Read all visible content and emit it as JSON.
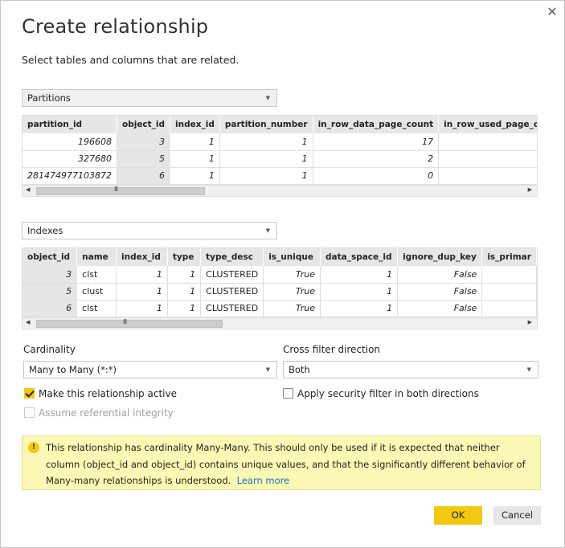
{
  "dialog": {
    "title": "Create relationship",
    "subtitle": "Select tables and columns that are related.",
    "close_glyph": "✕"
  },
  "table1": {
    "selected": "Partitions",
    "columns": [
      "partition_id",
      "object_id",
      "index_id",
      "partition_number",
      "in_row_data_page_count",
      "in_row_used_page_count"
    ],
    "rows": [
      [
        "196608",
        "3",
        "1",
        "1",
        "17",
        ""
      ],
      [
        "327680",
        "5",
        "1",
        "1",
        "2",
        ""
      ],
      [
        "281474977103872",
        "6",
        "1",
        "1",
        "0",
        ""
      ]
    ],
    "selected_column": "object_id"
  },
  "table2": {
    "selected": "Indexes",
    "columns": [
      "object_id",
      "name",
      "index_id",
      "type",
      "type_desc",
      "is_unique",
      "data_space_id",
      "ignore_dup_key",
      "is_primar"
    ],
    "rows": [
      [
        "3",
        "clst",
        "1",
        "1",
        "CLUSTERED",
        "True",
        "1",
        "False",
        ""
      ],
      [
        "5",
        "clust",
        "1",
        "1",
        "CLUSTERED",
        "True",
        "1",
        "False",
        ""
      ],
      [
        "6",
        "clst",
        "1",
        "1",
        "CLUSTERED",
        "True",
        "1",
        "False",
        ""
      ]
    ],
    "selected_column": "object_id"
  },
  "scrollbar": {
    "grip": "III",
    "left": "◀",
    "right": "▶"
  },
  "cardinality": {
    "label": "Cardinality",
    "value": "Many to Many (*:*)"
  },
  "crossfilter": {
    "label": "Cross filter direction",
    "value": "Both"
  },
  "options": {
    "active_label": "Make this relationship active",
    "active_checked": true,
    "security_label": "Apply security filter in both directions",
    "security_checked": false,
    "integrity_label": "Assume referential integrity",
    "integrity_checked": false
  },
  "warning": {
    "icon": "!",
    "text": "This relationship has cardinality Many-Many. This should only be used if it is expected that neither column (object_id and object_id) contains unique values, and that the significantly different behavior of Many-many relationships is understood.",
    "link": "Learn more"
  },
  "buttons": {
    "ok": "OK",
    "cancel": "Cancel"
  },
  "colors": {
    "accent": "#f2c811",
    "warning_bg": "#fbf7b4",
    "link": "#1a6fb5"
  }
}
